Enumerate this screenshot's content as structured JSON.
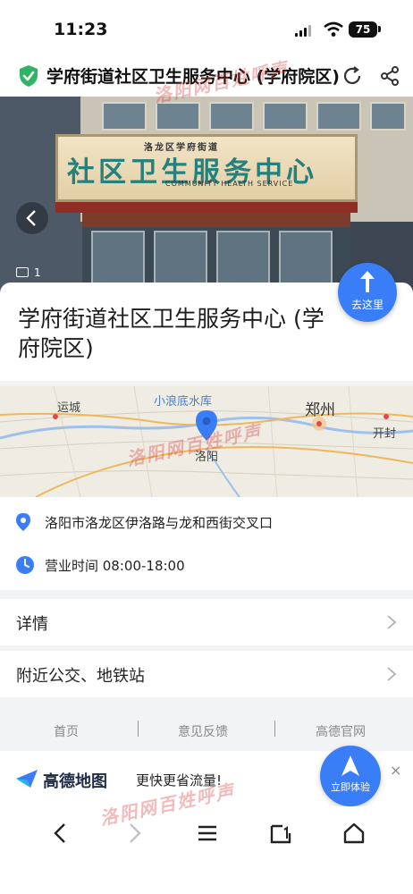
{
  "status": {
    "time": "11:23",
    "battery": "75"
  },
  "header": {
    "title": "学府街道社区卫生服务中心 (学府院区)"
  },
  "photo": {
    "count": "1",
    "sign_top": "洛龙区学府街道",
    "sign_main": "社区卫生服务中心",
    "sign_en": "COMMUNITY  HEALTH  SERVICE"
  },
  "poi": {
    "title": "学府街道社区卫生服务中心 (学府院区)",
    "go_label": "去这里"
  },
  "map": {
    "labels": {
      "yuncheng": "运城",
      "xiaolangdi": "小浪底水库",
      "zhengzhou": "郑州",
      "kaifeng": "开封",
      "luoyang": "洛阳"
    }
  },
  "info": {
    "address": "洛阳市洛龙区伊洛路与龙和西街交叉口",
    "hours": "营业时间 08:00-18:00"
  },
  "nav": {
    "details": "详情",
    "transit": "附近公交、地铁站"
  },
  "footer": {
    "home": "首页",
    "feedback": "意见反馈",
    "official": "高德官网"
  },
  "promo": {
    "brand": "高德地图",
    "slogan": "更快更省流量!",
    "try_label": "立即体验",
    "close": "×"
  },
  "watermark": "洛阳网百姓呼声",
  "colors": {
    "accent": "#3a7ef7",
    "shield": "#2db563"
  }
}
